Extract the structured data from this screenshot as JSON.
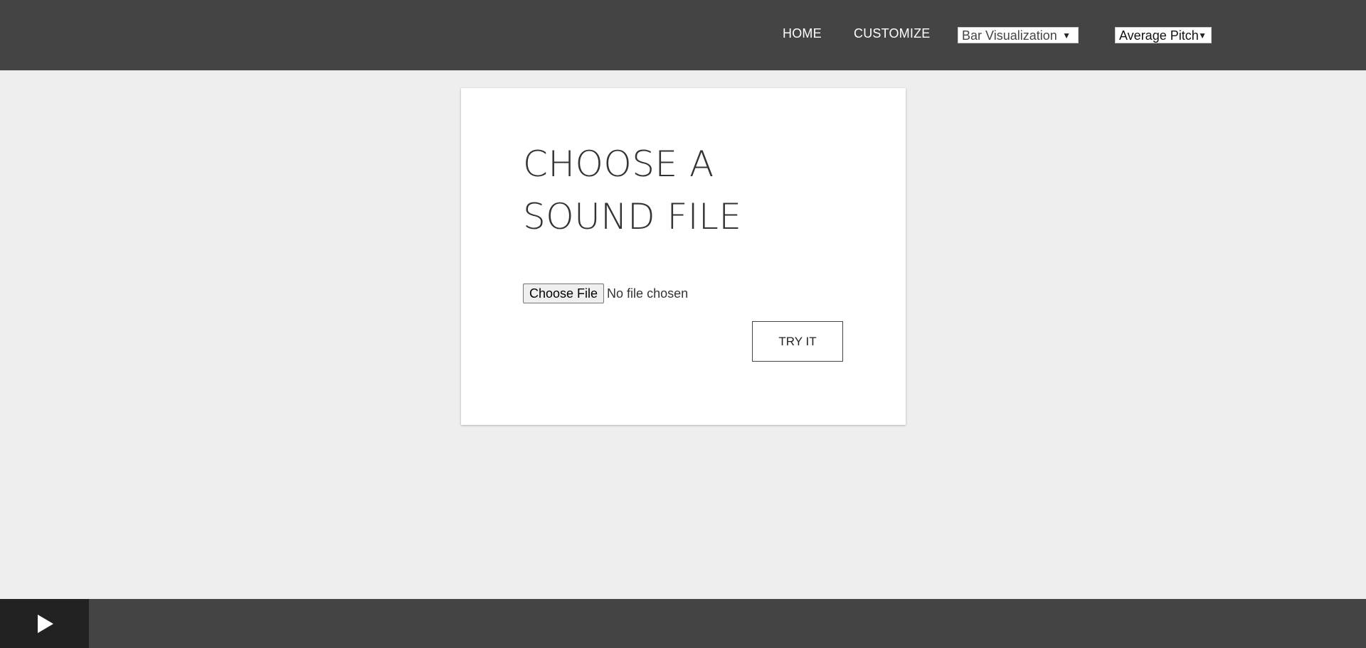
{
  "nav": {
    "links": [
      {
        "label": "HOME"
      },
      {
        "label": "CUSTOMIZE"
      }
    ],
    "visualization_select": {
      "value": "Bar Visualization"
    },
    "metric_select": {
      "value": "Average Pitch"
    }
  },
  "card": {
    "title": "CHOOSE A SOUND FILE",
    "file_input": {
      "button_label": "Choose File",
      "status": "No file chosen"
    },
    "submit_label": "TRY IT"
  },
  "player": {
    "play_icon": "play-icon"
  },
  "colors": {
    "topbar": "#444444",
    "background": "#eeeeee",
    "card": "#ffffff",
    "player_bar": "#444444",
    "play_button": "#222222"
  }
}
